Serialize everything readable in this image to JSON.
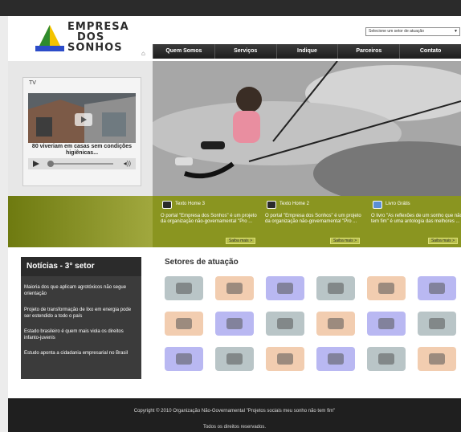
{
  "logo": {
    "line1": "EMPRESA",
    "line2": "DOS",
    "line3": "SONHOS"
  },
  "search": {
    "select_value": "Selecione um setor de atuação"
  },
  "nav": {
    "items": [
      "Quem Somos",
      "Serviços",
      "Indique",
      "Parceiros",
      "Contato"
    ]
  },
  "tv": {
    "label": "TV",
    "caption": "80 viveriam em casas sem condições higiênicas..."
  },
  "home_cards": [
    {
      "title": "Texto Home 3",
      "text": "O portal \"Empresa dos Sonhos\" é um projeto da organização não-governamental \"Pro ...",
      "more": "Saiba mais >"
    },
    {
      "title": "Texto Home 2",
      "text": "O portal \"Empresa dos Sonhos\" é um projeto da organização não-governamental \"Pro ...",
      "more": "Saiba mais >"
    },
    {
      "title": "Livro Grátis",
      "text": "O livro \"As reflexões de um sonho que não tem fim\" é uma antologia das melhores ...",
      "more": "Saiba mais >"
    }
  ],
  "news": {
    "title": "Notícias - 3° setor",
    "items": [
      "Maioria dos que aplicam agrotóxicos não segue orientação",
      "Projeto de transformação de lixo em energia pode ser estendido a todo o país",
      "Estado brasileiro é quem mais viola os direitos infanto-juvenis",
      "Estudo aponta a cidadania empresarial no Brasil"
    ]
  },
  "sectors": {
    "title": "Setores de atuação",
    "icons": [
      {
        "name": "shopping-cart-icon",
        "color": "#b9c5c7"
      },
      {
        "name": "car-icon",
        "color": "#f2cdb0"
      },
      {
        "name": "globe-network-icon",
        "color": "#b9b8f2"
      },
      {
        "name": "gift-box-icon",
        "color": "#b9c5c7"
      },
      {
        "name": "tv-icon",
        "color": "#f2cdb0"
      },
      {
        "name": "lightbulb-icon",
        "color": "#b9b8f2"
      },
      {
        "name": "pills-icon",
        "color": "#f2cdb0"
      },
      {
        "name": "bricks-icon",
        "color": "#b9b8f2"
      },
      {
        "name": "battery-icon",
        "color": "#b9c5c7"
      },
      {
        "name": "cargo-ship-icon",
        "color": "#f2cdb0"
      },
      {
        "name": "recycle-icon",
        "color": "#b9b8f2"
      },
      {
        "name": "chart-icon",
        "color": "#b9c5c7"
      },
      {
        "name": "safe-icon",
        "color": "#b9b8f2"
      },
      {
        "name": "wallet-card-icon",
        "color": "#b9c5c7"
      },
      {
        "name": "factory-icon",
        "color": "#f2cdb0"
      },
      {
        "name": "telephone-icon",
        "color": "#b9b8f2"
      },
      {
        "name": "jacket-icon",
        "color": "#b9c5c7"
      },
      {
        "name": "airplane-icon",
        "color": "#f2cdb0"
      }
    ]
  },
  "footer": {
    "line1": "Copyright © 2010 Organização Não-Governamental \"Projetos sociais meu sonho não tem fim\"",
    "line2": "Todos os direitos reservados."
  },
  "colors": {
    "olive": "#8a9520",
    "nav_dark": "#2b2b2b",
    "logo_green": "#2e8b2e",
    "logo_blue": "#2c4cc9",
    "logo_yellow": "#f3c300"
  }
}
